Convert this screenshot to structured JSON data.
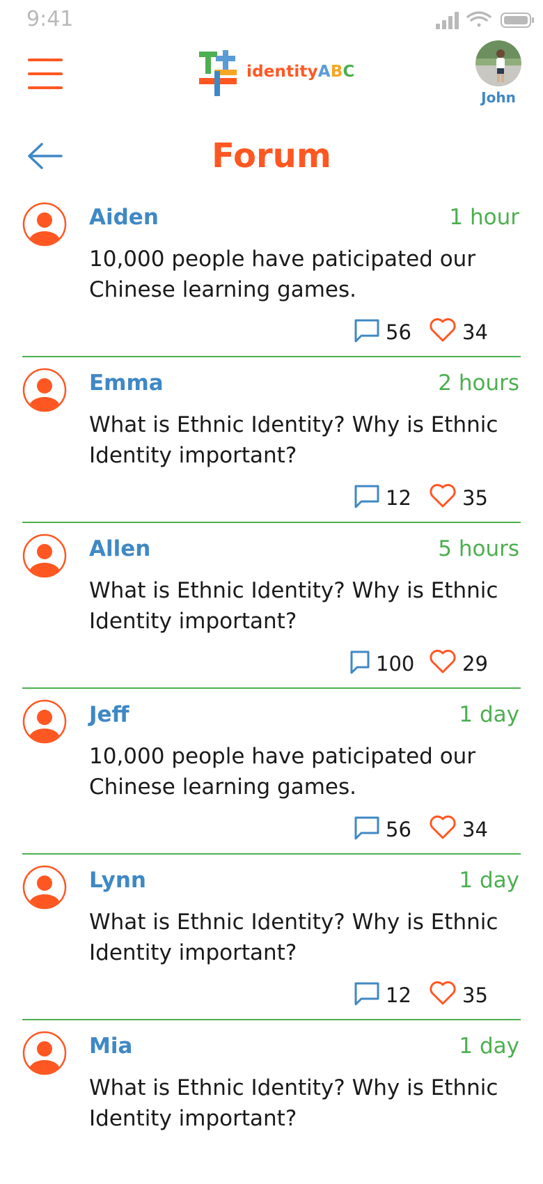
{
  "status_bar": {
    "time": "9:41"
  },
  "header": {
    "logo": {
      "text_identity": "identity",
      "text_a": "A",
      "text_b": "B",
      "text_c": "C"
    },
    "user": {
      "name": "John"
    }
  },
  "page": {
    "title": "Forum"
  },
  "posts": [
    {
      "name": "Aiden",
      "time": "1 hour",
      "text": "10,000 people have paticipated our Chinese learning games.",
      "comments": "56",
      "likes": "34"
    },
    {
      "name": "Emma",
      "time": "2 hours",
      "text": "What is Ethnic Identity?  Why is Ethnic Identity important?",
      "comments": "12",
      "likes": "35"
    },
    {
      "name": "Allen",
      "time": "5 hours",
      "text": "What is Ethnic Identity?  Why is Ethnic Identity important?",
      "comments": "100",
      "likes": "29"
    },
    {
      "name": "Jeff",
      "time": "1 day",
      "text": "10,000 people have paticipated our Chinese learning games.",
      "comments": "56",
      "likes": "34"
    },
    {
      "name": "Lynn",
      "time": "1 day",
      "text": "What is Ethnic Identity?  Why is Ethnic Identity important?",
      "comments": "12",
      "likes": "35"
    },
    {
      "name": "Mia",
      "time": "1 day",
      "text": "What is Ethnic Identity?  Why is Ethnic Identity important?",
      "comments": "",
      "likes": ""
    }
  ],
  "colors": {
    "accent": "#ff5722",
    "name_blue": "#3f88c5",
    "time_green": "#4caf50",
    "divider": "#4caf50"
  },
  "icons": {
    "menu": "hamburger-icon",
    "back": "arrow-left-icon",
    "post_avatar": "user-circle-icon",
    "comment": "speech-bubble-icon",
    "like": "heart-icon"
  }
}
